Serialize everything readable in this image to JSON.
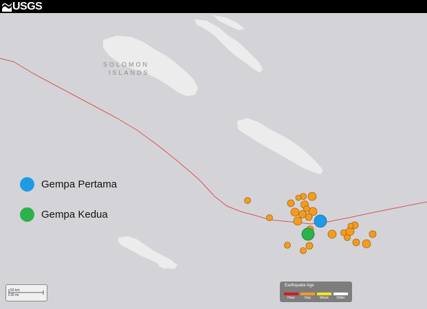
{
  "header": {
    "logo_text": "USGS",
    "logo_icon": "usgs-wave-icon"
  },
  "map": {
    "island_label_line1": "SOLOMON",
    "island_label_line2": "ISLANDS"
  },
  "legend": [
    {
      "label": "Gempa Pertama",
      "color": "#1e9be6"
    },
    {
      "label": "Gempa Kedua",
      "color": "#2bb24c"
    }
  ],
  "scale": {
    "top_label": "50 km",
    "bottom_label": "30 mi"
  },
  "earthquake_age": {
    "title": "Earthquake Age",
    "items": [
      {
        "label": "Hour",
        "color": "#d7191c"
      },
      {
        "label": "Day",
        "color": "#f39c1f"
      },
      {
        "label": "Week",
        "color": "#f7e51c"
      },
      {
        "label": "Older",
        "color": "#ffffff"
      }
    ]
  },
  "colors": {
    "quake_fill": "#f39c1f",
    "plate_boundary": "#d9534f",
    "land": "#ececec",
    "water": "#d4d4d8"
  }
}
